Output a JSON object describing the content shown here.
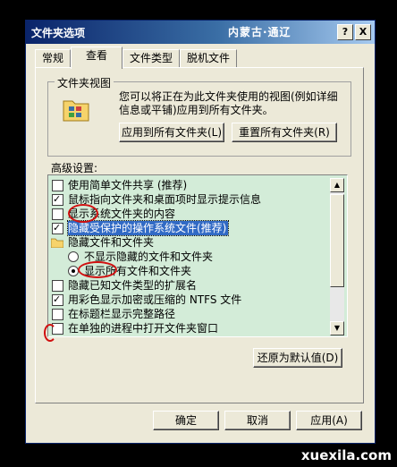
{
  "window": {
    "title": "文件夹选项",
    "logo_text": "内蒙古·通辽",
    "help_label": "?",
    "close_label": "X"
  },
  "tabs": [
    {
      "label": "常规",
      "active": false
    },
    {
      "label": "查看",
      "active": true
    },
    {
      "label": "文件类型",
      "active": false
    },
    {
      "label": "脱机文件",
      "active": false
    }
  ],
  "folder_views": {
    "legend": "文件夹视图",
    "description": "您可以将正在为此文件夹使用的视图(例如详细信息或平铺)应用到所有文件夹。",
    "apply_all_label": "应用到所有文件夹(L)",
    "reset_all_label": "重置所有文件夹(R)"
  },
  "advanced": {
    "label": "高级设置:",
    "items": [
      {
        "type": "checkbox",
        "checked": false,
        "indent": 0,
        "label": "使用简单文件共享 (推荐)"
      },
      {
        "type": "checkbox",
        "checked": true,
        "indent": 0,
        "label": "鼠标指向文件夹和桌面项时显示提示信息"
      },
      {
        "type": "checkbox",
        "checked": false,
        "indent": 0,
        "label": "显示系统文件夹的内容"
      },
      {
        "type": "checkbox",
        "checked": true,
        "indent": 0,
        "label": "隐藏受保护的操作系统文件(推荐)",
        "selected": true
      },
      {
        "type": "folder",
        "indent": 0,
        "label": "隐藏文件和文件夹"
      },
      {
        "type": "radio",
        "checked": false,
        "indent": 1,
        "label": "不显示隐藏的文件和文件夹"
      },
      {
        "type": "radio",
        "checked": true,
        "indent": 1,
        "label": "显示所有文件和文件夹"
      },
      {
        "type": "checkbox",
        "checked": false,
        "indent": 0,
        "label": "隐藏已知文件类型的扩展名"
      },
      {
        "type": "checkbox",
        "checked": true,
        "indent": 0,
        "label": "用彩色显示加密或压缩的 NTFS 文件"
      },
      {
        "type": "checkbox",
        "checked": false,
        "indent": 0,
        "label": "在标题栏显示完整路径"
      },
      {
        "type": "checkbox",
        "checked": false,
        "indent": 0,
        "label": "在单独的进程中打开文件夹窗口"
      }
    ],
    "restore_defaults_label": "还原为默认值(D)"
  },
  "footer": {
    "ok_label": "确定",
    "cancel_label": "取消",
    "apply_label": "应用(A)"
  },
  "watermark": "xuexila.com",
  "colors": {
    "list_background": "#d3ecd8",
    "annotation_circle": "#d01010",
    "selection": "#316ac5"
  }
}
